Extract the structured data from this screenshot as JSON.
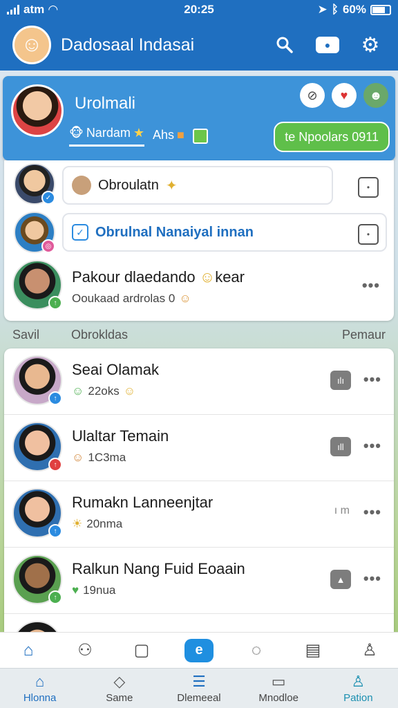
{
  "status_bar": {
    "carrier": "atm",
    "time": "20:25",
    "battery": "60%"
  },
  "app_bar": {
    "title": "Dadosaal Indasai"
  },
  "highlight": {
    "name": "Urolmali",
    "tabs": [
      "Nardam",
      "Ahs"
    ],
    "cta_label": "te Npoolars 0911"
  },
  "top_card": {
    "input_1": "Obroulatn",
    "input_2": "Obrulnal Nanaiyal innan",
    "row_title": "Pakour dlaedando",
    "row_title_suffix": "kear",
    "row_sub": "Ooukaad ardrolas 0"
  },
  "section": {
    "left": "Savil",
    "middle": "Obrokldas",
    "right": "Pemaur"
  },
  "list": [
    {
      "title": "Seai Olamak",
      "sub": "22oks",
      "chip": "ılı",
      "chip_type": "chip"
    },
    {
      "title": "Ulaltar Temain",
      "sub": "1C3ma",
      "chip": "ıll",
      "chip_type": "chip"
    },
    {
      "title": "Rumakn Lanneenjtar",
      "sub": "20nma",
      "chip": "ı m",
      "chip_type": "text"
    },
    {
      "title": "Ralkun Nang Fuid Eoaain",
      "sub": "19nua",
      "chip": "▲",
      "chip_type": "chip"
    }
  ],
  "bottom_nav": [
    {
      "label": "Hlonna",
      "icon": "home-icon"
    },
    {
      "label": "Same",
      "icon": "diamond-icon"
    },
    {
      "label": "Dlemeeal",
      "icon": "stack-icon"
    },
    {
      "label": "Mnodloe",
      "icon": "book-icon"
    },
    {
      "label": "Pation",
      "icon": "person-icon"
    }
  ],
  "colors": {
    "primary": "#1f6fc0",
    "panel": "#3d93d9",
    "cta": "#5fbf4a"
  }
}
